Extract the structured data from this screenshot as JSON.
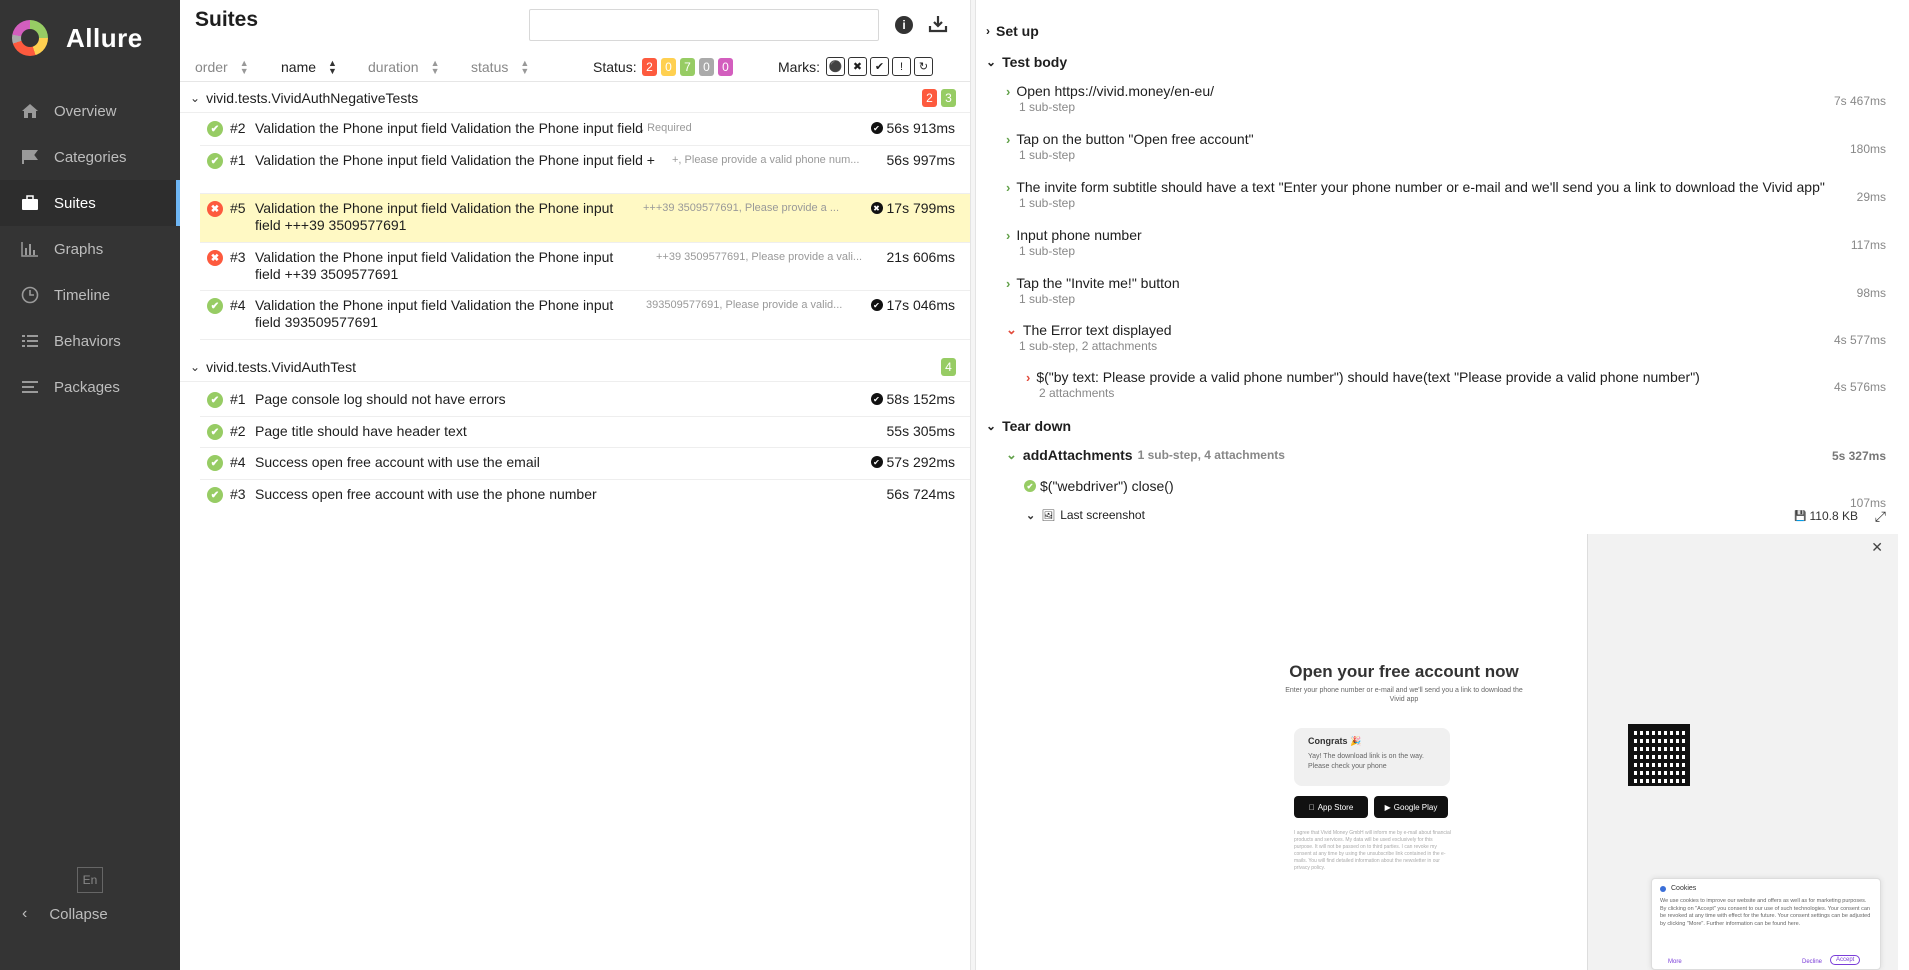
{
  "app": {
    "name": "Allure"
  },
  "sidebar": {
    "items": [
      {
        "label": "Overview",
        "icon": "home-icon"
      },
      {
        "label": "Categories",
        "icon": "flag-icon"
      },
      {
        "label": "Suites",
        "icon": "briefcase-icon"
      },
      {
        "label": "Graphs",
        "icon": "bar-chart-icon"
      },
      {
        "label": "Timeline",
        "icon": "clock-icon"
      },
      {
        "label": "Behaviors",
        "icon": "list-icon"
      },
      {
        "label": "Packages",
        "icon": "align-left-icon"
      }
    ],
    "language": "En",
    "collapse_label": "Collapse"
  },
  "suites": {
    "title": "Suites",
    "search": {
      "value": "",
      "placeholder": ""
    },
    "sort": {
      "order": "order",
      "name": "name",
      "duration": "duration",
      "status": "status"
    },
    "status_label": "Status:",
    "status_counts": {
      "failed": "2",
      "broken": "0",
      "passed": "7",
      "skipped": "0",
      "unknown": "0"
    },
    "marks_label": "Marks:",
    "groups": [
      {
        "name": "vivid.tests.VividAuthNegativeTests",
        "badge_failed": "2",
        "badge_passed": "3",
        "rows": [
          {
            "num": "#2",
            "name": "Validation the Phone input field Validation the Phone input field",
            "params": ", Required",
            "duration": "56s 913ms"
          },
          {
            "num": "#1",
            "name": "Validation the Phone input field Validation the Phone input field +",
            "params": "+, Please provide a valid phone num...",
            "duration": "56s 997ms"
          },
          {
            "num": "#5",
            "name": "Validation the Phone input field Validation the Phone input field +++39 3509577691",
            "params": "+++39 3509577691, Please provide a ...",
            "duration": "17s 799ms"
          },
          {
            "num": "#3",
            "name": "Validation the Phone input field Validation the Phone input field ++39 3509577691",
            "params": "++39 3509577691, Please provide a vali...",
            "duration": "21s 606ms"
          },
          {
            "num": "#4",
            "name": "Validation the Phone input field Validation the Phone input field 393509577691",
            "params": "393509577691, Please provide a valid...",
            "duration": "17s 046ms"
          }
        ]
      },
      {
        "name": "vivid.tests.VividAuthTest",
        "badge_passed": "4",
        "rows": [
          {
            "num": "#1",
            "name": "Page console log should not have errors",
            "duration": "58s 152ms"
          },
          {
            "num": "#2",
            "name": "Page title should have header text",
            "duration": "55s 305ms"
          },
          {
            "num": "#4",
            "name": "Success open free account with use the email",
            "duration": "57s 292ms"
          },
          {
            "num": "#3",
            "name": "Success open free account with use the phone number",
            "duration": "56s 724ms"
          }
        ]
      }
    ]
  },
  "details": {
    "setup_label": "Set up",
    "body_label": "Test body",
    "teardown_label": "Tear down",
    "steps": [
      {
        "title": "Open https://vivid.money/en-eu/",
        "sub": "1 sub-step",
        "duration": "7s 467ms"
      },
      {
        "title": "Tap on the button \"Open free account\"",
        "sub": "1 sub-step",
        "duration": "180ms"
      },
      {
        "title": "The invite form subtitle should have a text \"Enter your phone number or e-mail and we'll send you a link to download the Vivid app\"",
        "sub": "1 sub-step",
        "duration": "29ms"
      },
      {
        "title": "Input phone number",
        "sub": "1 sub-step",
        "duration": "117ms"
      },
      {
        "title": "Tap the \"Invite me!\" button",
        "sub": "1 sub-step",
        "duration": "98ms"
      },
      {
        "title": "The Error text displayed",
        "sub": "1 sub-step, 2 attachments",
        "duration": "4s 577ms"
      }
    ],
    "nested_step": {
      "title": "$(\"by text: Please provide a valid phone number\") should have(text \"Please provide a valid phone number\")",
      "sub": "2 attachments",
      "duration": "4s 576ms"
    },
    "teardown_step": {
      "title": "addAttachments",
      "meta": "1 sub-step, 4 attachments",
      "duration": "5s 327ms"
    },
    "close_step": {
      "title": "$(\"webdriver\") close()",
      "duration": "107ms"
    },
    "attachment": {
      "title": "Last screenshot",
      "size": "110.8 KB"
    },
    "screenshot": {
      "heading": "Open your free account now",
      "subtitle": "Enter your phone number or e-mail and we'll send you a link to download the Vivid app",
      "card_title": "Congrats 🎉",
      "card_text": "Yay! The download link is on the way. Please check your phone",
      "app_store": "App Store",
      "google_play": "Google Play",
      "fine_print": "I agree that Vivid Money GmbH will inform me by e-mail about financial products and services. My data will be used exclusively for this purpose. It will not be passed on to third parties. I can revoke my consent at any time by using the unsubscribe link contained in the e-mails. You will find detailed information about the newsletter in our privacy policy.",
      "cookie_title": "Cookies",
      "cookie_text": "We use cookies to improve our website and offers as well as for marketing purposes. By clicking on \"Accept\" you consent to our use of such technologies. Your consent can be revoked at any time with effect for the future. Your consent settings can be adjusted by clicking \"More\". Further information can be found here.",
      "cookie_more": "More",
      "cookie_decline": "Decline",
      "cookie_accept": "Accept"
    }
  },
  "colors": {
    "failed": "#fd5a3e",
    "broken": "#ffd050",
    "passed": "#97cc64",
    "skipped": "#aaaaaa",
    "unknown": "#d35ebe",
    "accent": "#6eb5f3"
  }
}
